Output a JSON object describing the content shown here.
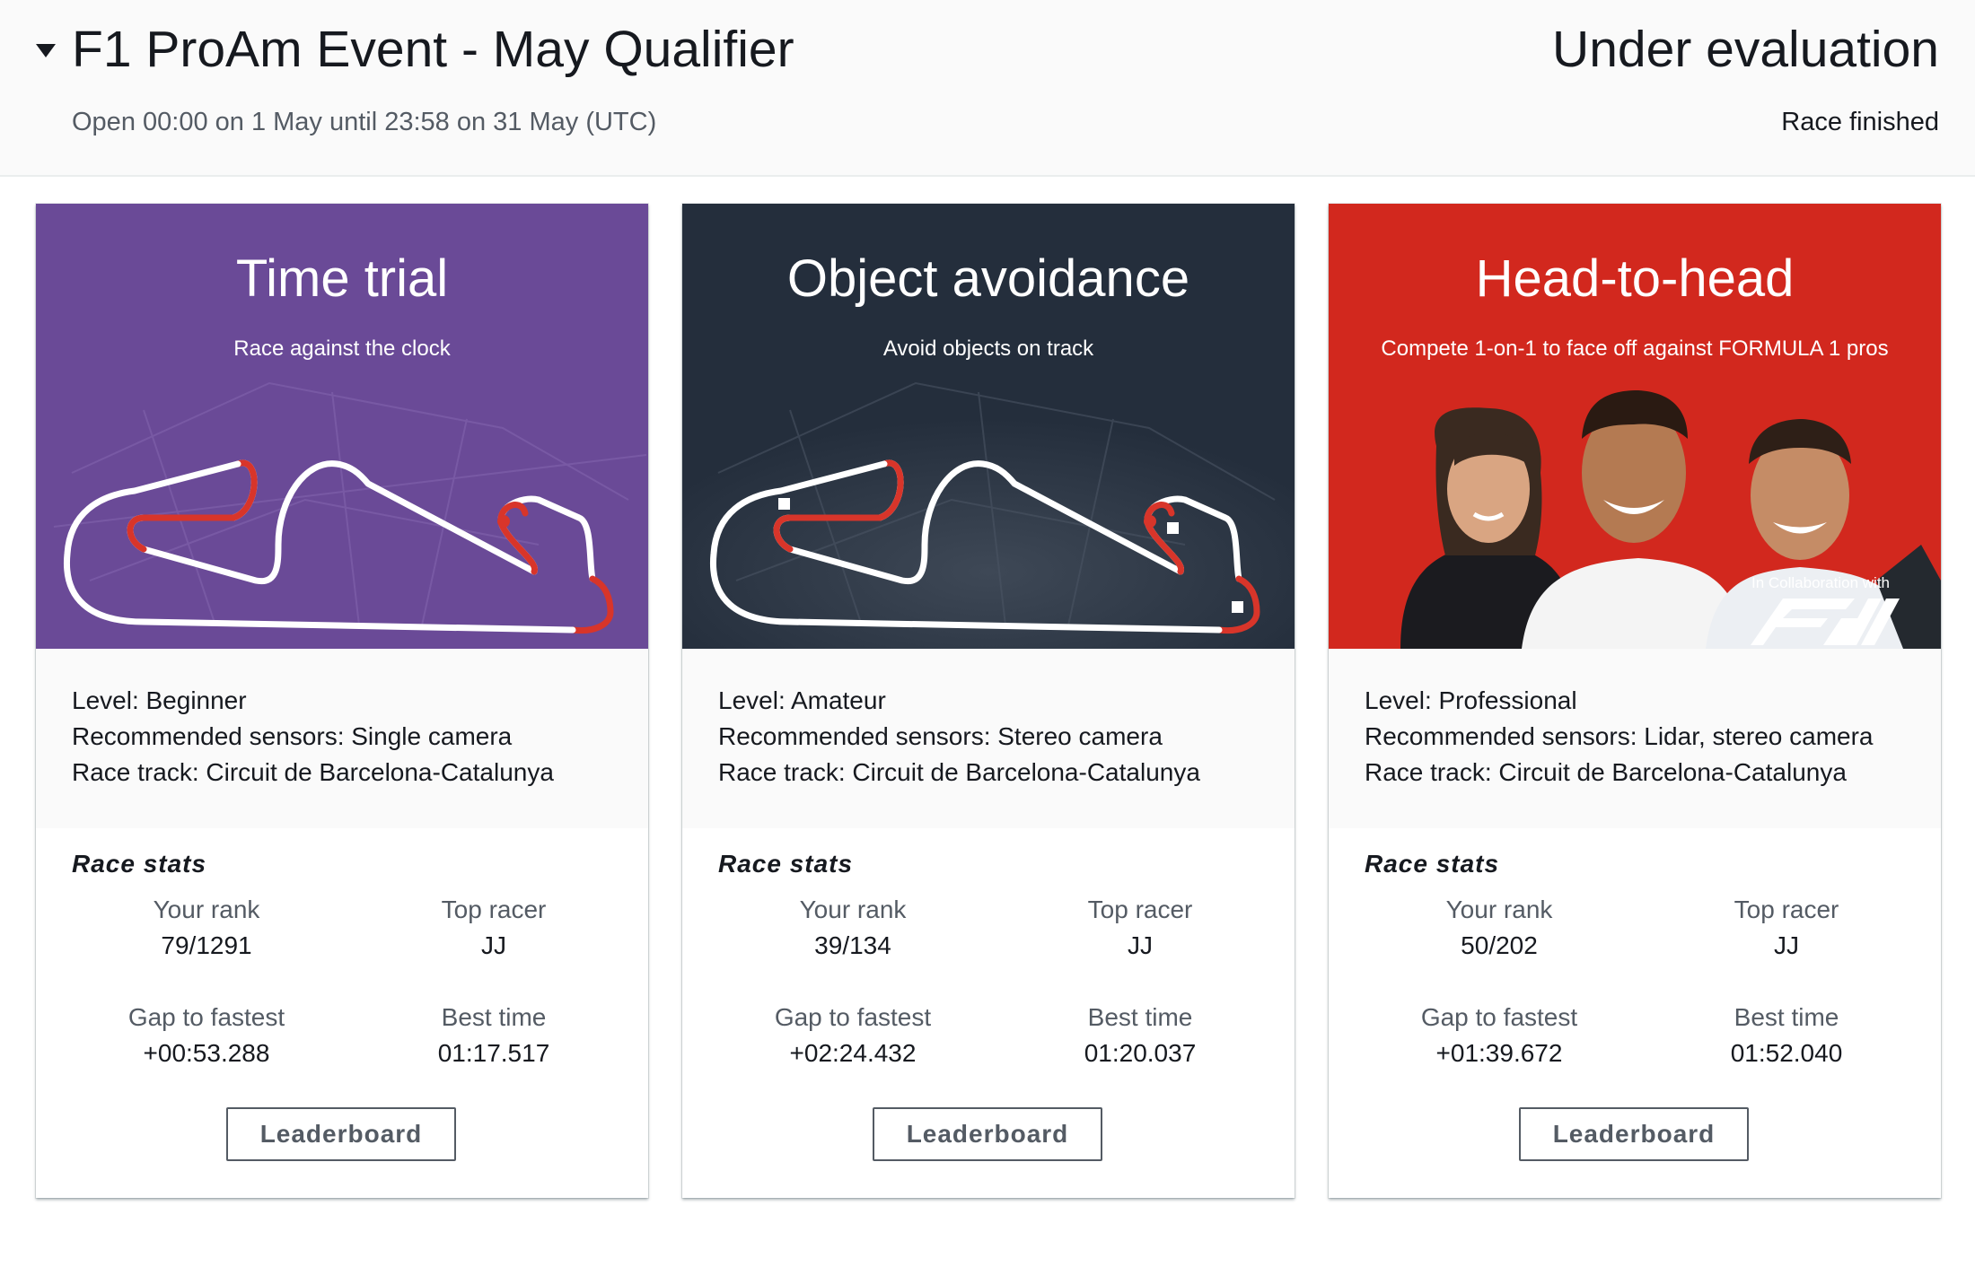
{
  "event": {
    "title": "F1 ProAm Event - May Qualifier",
    "window": "Open 00:00 on 1 May until 23:58 on 31 May (UTC)",
    "status": "Under evaluation",
    "race_status": "Race finished"
  },
  "colors": {
    "time_trial": "#6a4a97",
    "object_avoidance": "#242e3c",
    "head_to_head": "#d2281e",
    "track_highlight": "#d8352a"
  },
  "cards": [
    {
      "title": "Time trial",
      "subtitle": "Race against the clock",
      "level": "Level: Beginner",
      "sensors": "Recommended sensors: Single camera",
      "track": "Race track: Circuit de Barcelona-Catalunya",
      "stats_title": "Race stats",
      "rank_label": "Your rank",
      "rank": "79/1291",
      "top_label": "Top racer",
      "top": "JJ",
      "gap_label": "Gap to fastest",
      "gap": "+00:53.288",
      "best_label": "Best time",
      "best": "01:17.517",
      "button": "Leaderboard"
    },
    {
      "title": "Object avoidance",
      "subtitle": "Avoid objects on track",
      "level": "Level: Amateur",
      "sensors": "Recommended sensors: Stereo camera",
      "track": "Race track: Circuit de Barcelona-Catalunya",
      "stats_title": "Race stats",
      "rank_label": "Your rank",
      "rank": "39/134",
      "top_label": "Top racer",
      "top": "JJ",
      "gap_label": "Gap to fastest",
      "gap": "+02:24.432",
      "best_label": "Best time",
      "best": "01:20.037",
      "button": "Leaderboard"
    },
    {
      "title": "Head-to-head",
      "subtitle": "Compete 1-on-1 to face off against FORMULA 1 pros",
      "level": "Level: Professional",
      "sensors": "Recommended sensors: Lidar, stereo camera",
      "track": "Race track: Circuit de Barcelona-Catalunya",
      "stats_title": "Race stats",
      "rank_label": "Your rank",
      "rank": "50/202",
      "top_label": "Top racer",
      "top": "JJ",
      "gap_label": "Gap to fastest",
      "gap": "+01:39.672",
      "best_label": "Best time",
      "best": "01:52.040",
      "button": "Leaderboard",
      "collab_text": "In Collaboration with",
      "logo_text": "F1"
    }
  ]
}
